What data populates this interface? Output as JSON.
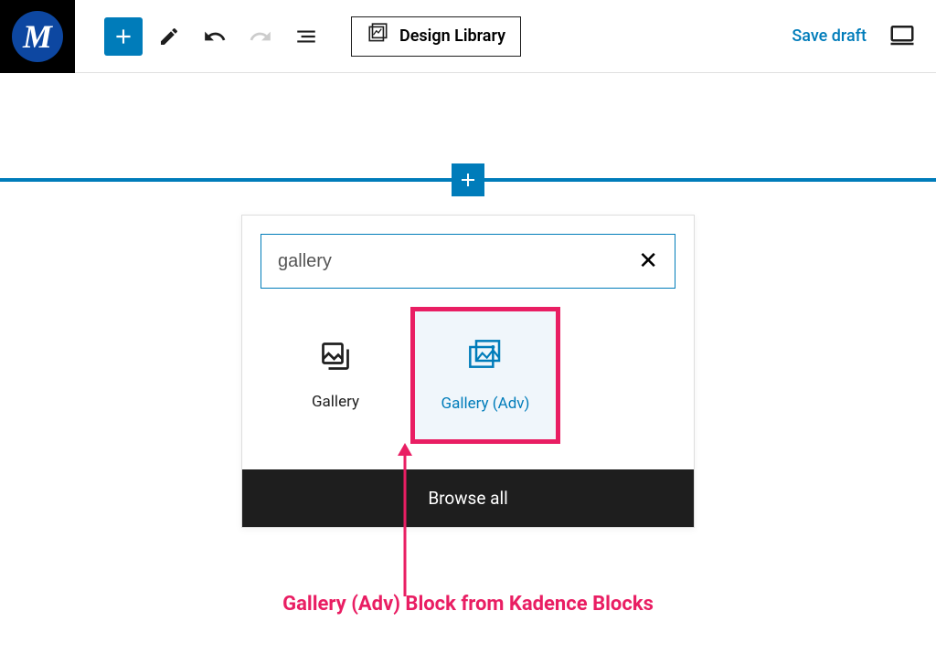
{
  "toolbar": {
    "logo_letter": "M",
    "design_library_label": "Design Library",
    "save_draft_label": "Save draft"
  },
  "inserter": {
    "search_value": "gallery",
    "blocks": [
      {
        "label": "Gallery",
        "selected": false
      },
      {
        "label": "Gallery (Adv)",
        "selected": true
      }
    ],
    "browse_all_label": "Browse all"
  },
  "annotation": {
    "text": "Gallery (Adv) Block from Kadence Blocks"
  }
}
